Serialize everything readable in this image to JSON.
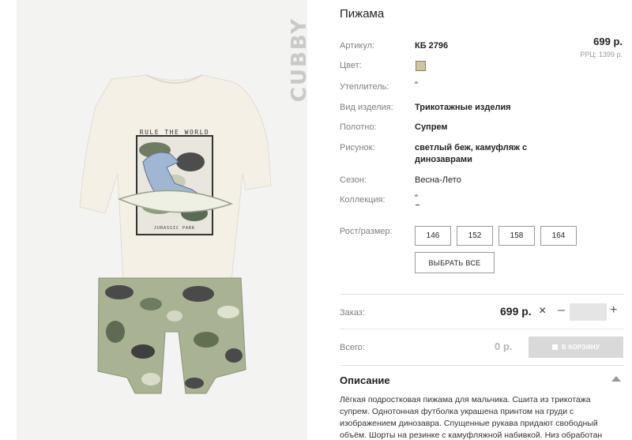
{
  "product": {
    "brand": "CUBBY",
    "title": "Пижама",
    "price": "699 р.",
    "rrp": "РРЦ: 1399 р.",
    "print_header": "RULE THE WORLD",
    "print_footer": "JURASSIC PARK"
  },
  "specs": [
    {
      "label": "Артикул:",
      "value": "КБ 2796"
    },
    {
      "label": "Цвет:",
      "value": ""
    },
    {
      "label": "Утеплитель:",
      "value": "\""
    },
    {
      "label": "Вид изделия:",
      "value": "Трикотажные изделия"
    },
    {
      "label": "Полотно:",
      "value": "Супрем"
    },
    {
      "label": "Рисунок:",
      "value": "светлый беж, камуфляж с динозаврами"
    },
    {
      "label": "Сезон:",
      "value": "Весна-Лето"
    },
    {
      "label": "Коллекция:",
      "value": "\""
    },
    {
      "label": "Рост/размер:",
      "value": ""
    }
  ],
  "color_swatch": "#cfc4a5",
  "sizes": [
    "146",
    "152",
    "158",
    "164"
  ],
  "select_all_label": "ВЫБРАТЬ ВСЕ",
  "order": {
    "label": "Заказ:",
    "price": "699 р.",
    "times": "×",
    "minus": "–",
    "plus": "+",
    "qty": ""
  },
  "total": {
    "label": "Всего:",
    "value": "0 р.",
    "cart_label": "В КОРЗИНУ"
  },
  "description": {
    "title": "Описание",
    "text": "Лёгкая подростковая пижама для мальчика. Сшита из трикотажа супрем. Однотонная футболка украшена принтом на груди с изображением динозавра. Спущенные рукава придают свободный объём. Шорты на резинке с камуфляжной набивкой. Низ обработан"
  }
}
